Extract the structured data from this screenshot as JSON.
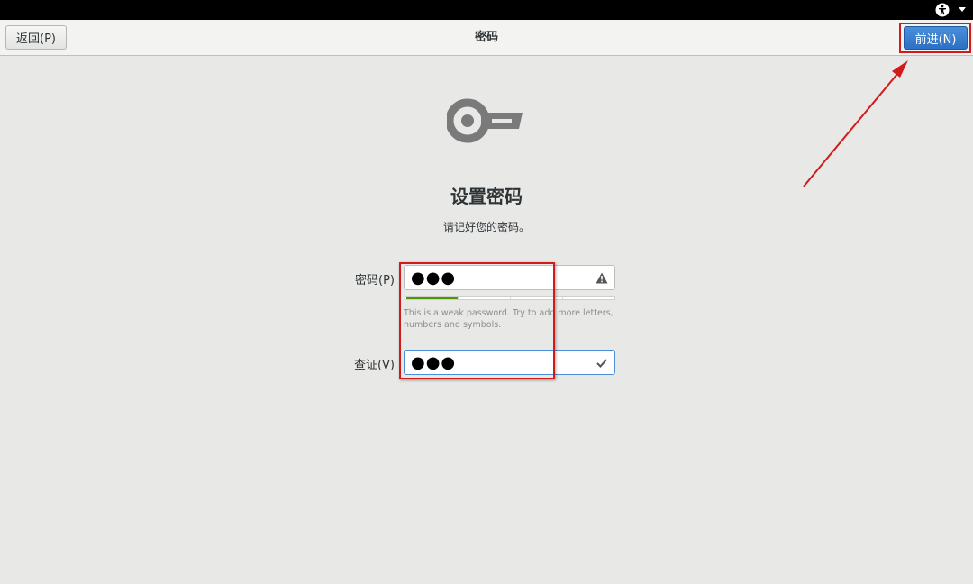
{
  "header": {
    "back_label": "返回(P)",
    "title": "密码",
    "next_label": "前进(N)"
  },
  "topbar": {
    "icons": [
      "accessibility-icon",
      "chevron-down-icon"
    ]
  },
  "main": {
    "icon": "key-icon",
    "title": "设置密码",
    "subtitle": "请记好您的密码。",
    "password": {
      "label": "密码(P)",
      "value": "●●●",
      "status_icon": "warning-icon",
      "strength_fraction": 0.25,
      "hint": "This is a weak password. Try to add more letters, numbers and symbols."
    },
    "confirm": {
      "label": "查证(V)",
      "value": "●●●",
      "status_icon": "checkmark-icon"
    }
  },
  "colors": {
    "accent": "#4a90d9",
    "annotation": "#d31a1a",
    "strength": "#4e9a06"
  }
}
